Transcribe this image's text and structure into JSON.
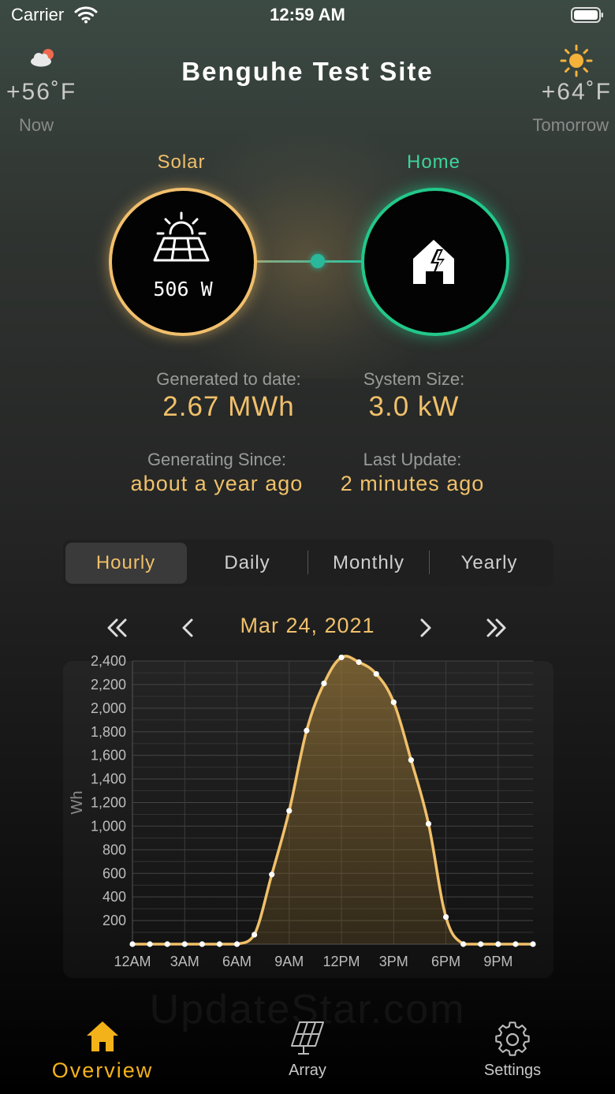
{
  "status_bar": {
    "carrier": "Carrier",
    "time": "12:59 AM"
  },
  "header": {
    "title": "Benguhe Test Site"
  },
  "weather": {
    "now": {
      "icon": "cloud-sun-icon",
      "temp": "+56˚F",
      "label": "Now"
    },
    "tomorrow": {
      "icon": "sun-icon",
      "temp": "+64˚F",
      "label": "Tomorrow"
    }
  },
  "flow": {
    "solar": {
      "label": "Solar",
      "watts": "506 W",
      "icon": "solar-panel-icon"
    },
    "home": {
      "label": "Home",
      "icon": "home-power-icon"
    }
  },
  "stats": {
    "generated_label": "Generated to date:",
    "generated_value": "2.67 MWh",
    "size_label": "System Size:",
    "size_value": "3.0 kW",
    "since_label": "Generating Since:",
    "since_value": "about a year ago",
    "update_label": "Last Update:",
    "update_value": "2 minutes ago"
  },
  "segments": [
    "Hourly",
    "Daily",
    "Monthly",
    "Yearly"
  ],
  "selected_segment": "Hourly",
  "date_nav": {
    "date": "Mar 24, 2021"
  },
  "chart_data": {
    "type": "area",
    "title": "",
    "ylabel": "Wh",
    "ylim": [
      0,
      2400
    ],
    "yticks": [
      "200",
      "400",
      "600",
      "800",
      "1,000",
      "1,200",
      "1,400",
      "1,600",
      "1,800",
      "2,000",
      "2,200",
      "2,400"
    ],
    "x_tick_labels": [
      "12AM",
      "3AM",
      "6AM",
      "9AM",
      "12PM",
      "3PM",
      "6PM",
      "9PM"
    ],
    "x": [
      0,
      1,
      2,
      3,
      4,
      5,
      6,
      7,
      8,
      9,
      10,
      11,
      12,
      13,
      14,
      15,
      16,
      17,
      18,
      19,
      20,
      21,
      22,
      23
    ],
    "values": [
      0,
      0,
      0,
      0,
      0,
      0,
      0,
      80,
      590,
      1130,
      1810,
      2210,
      2430,
      2390,
      2290,
      2050,
      1560,
      1020,
      230,
      0,
      0,
      0,
      0,
      0
    ],
    "color": "#f0c06a",
    "grid": true
  },
  "watermark": "UpdateStar.com",
  "tab_bar": [
    {
      "label": "Overview",
      "icon": "home-icon",
      "active": true
    },
    {
      "label": "Array",
      "icon": "solar-panel-icon",
      "active": false
    },
    {
      "label": "Settings",
      "icon": "gear-icon",
      "active": false
    }
  ],
  "colors": {
    "accent": "#f0c06a",
    "home": "#22c88a",
    "background": "#1a1a1a"
  }
}
